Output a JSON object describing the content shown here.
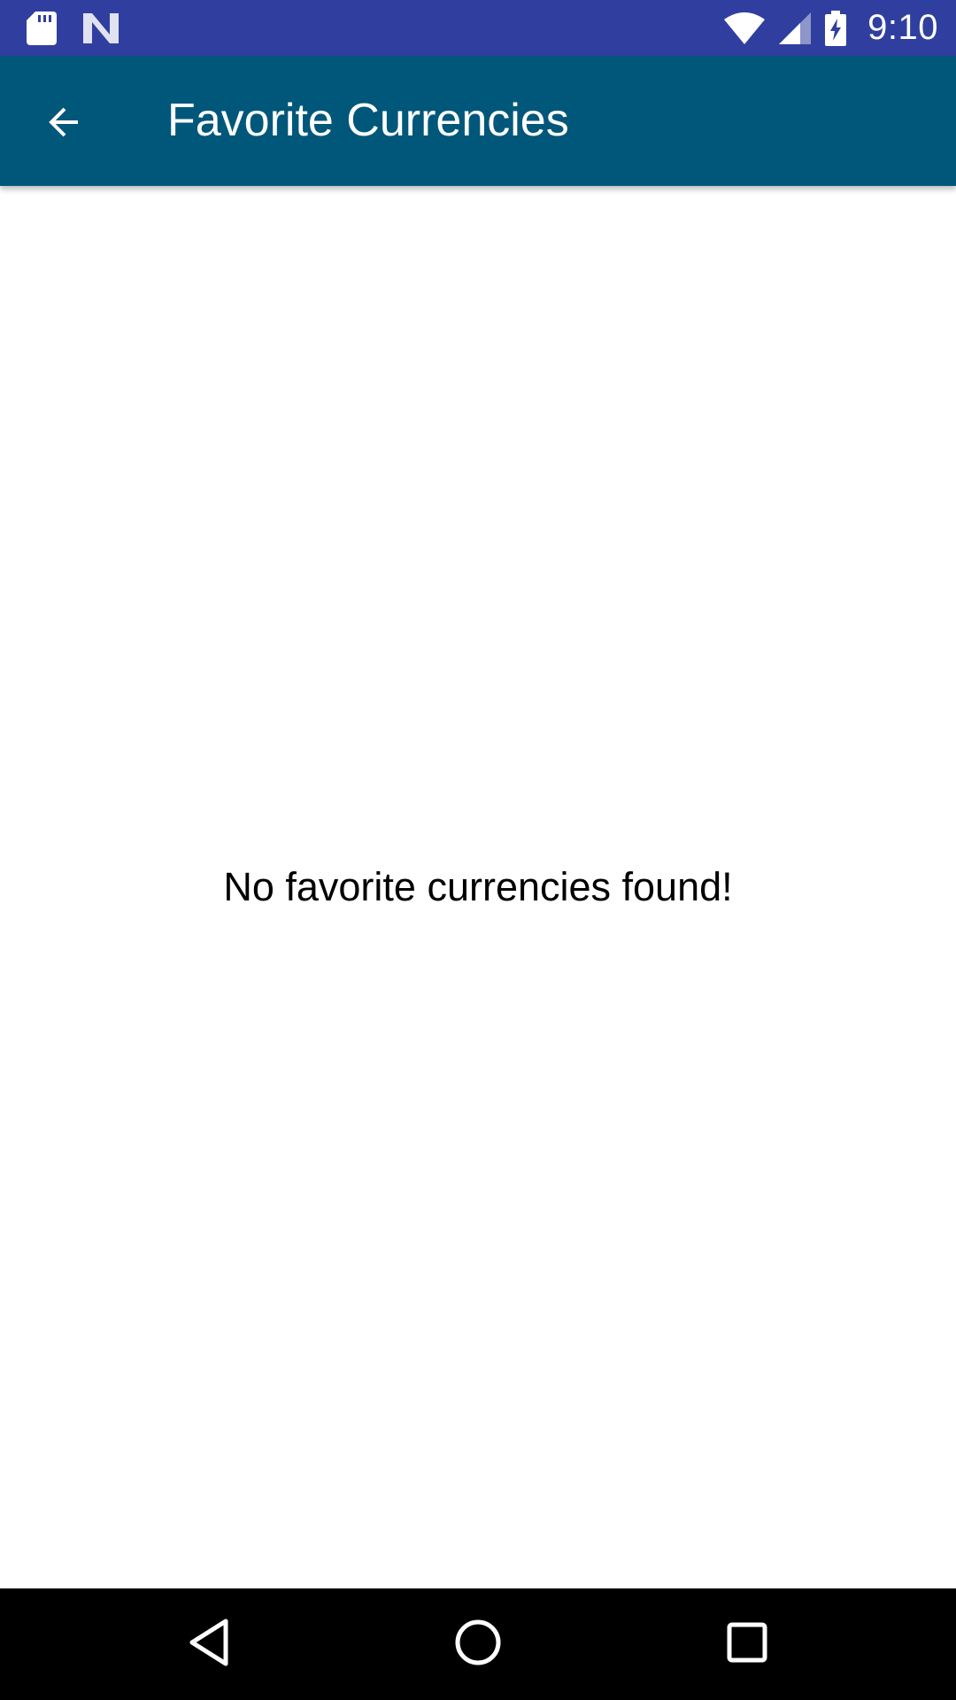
{
  "status_bar": {
    "time": "9:10",
    "left_icons": [
      "sd-card-icon",
      "n-logo-icon"
    ],
    "right_icons": [
      "wifi-icon",
      "cell-signal-icon",
      "battery-charging-icon"
    ],
    "background": "#303F9F"
  },
  "app_bar": {
    "title": "Favorite Currencies",
    "back_icon": "arrow-back-icon",
    "background": "#01577A"
  },
  "content": {
    "empty_message": "No favorite currencies found!"
  },
  "nav_bar": {
    "buttons": [
      "triangle-back-icon",
      "circle-home-icon",
      "square-recents-icon"
    ],
    "background": "#000000"
  }
}
